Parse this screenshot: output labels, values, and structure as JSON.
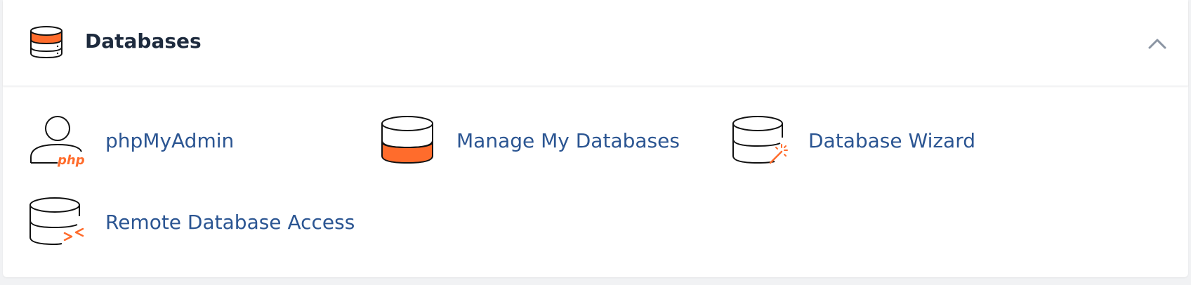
{
  "panel": {
    "title": "Databases",
    "icon": "database-icon",
    "collapse_icon": "chevron-up-icon",
    "accent_color": "#ff6c2c",
    "link_color": "#2b5592"
  },
  "items": [
    {
      "label": "phpMyAdmin",
      "icon": "phpmyadmin-icon"
    },
    {
      "label": "Manage My Databases",
      "icon": "manage-databases-icon"
    },
    {
      "label": "Database Wizard",
      "icon": "database-wizard-icon"
    },
    {
      "label": "Remote Database Access",
      "icon": "remote-database-access-icon"
    }
  ]
}
